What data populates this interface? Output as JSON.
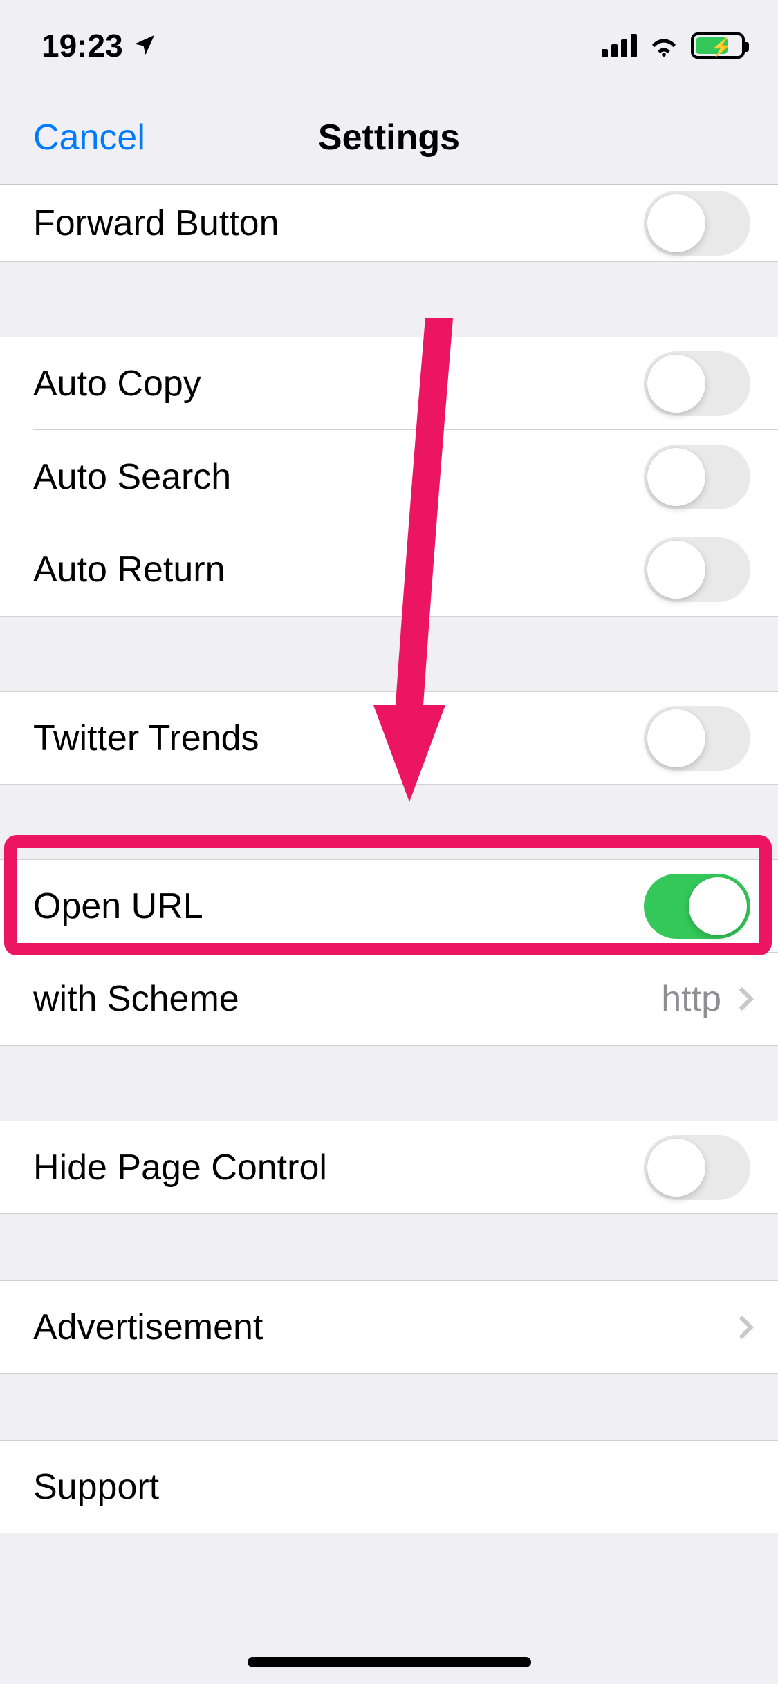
{
  "status": {
    "time": "19:23"
  },
  "nav": {
    "cancel": "Cancel",
    "title": "Settings"
  },
  "rows": {
    "forward_button": "Forward Button",
    "auto_copy": "Auto Copy",
    "auto_search": "Auto Search",
    "auto_return": "Auto Return",
    "twitter_trends": "Twitter Trends",
    "open_url": "Open URL",
    "with_scheme_label": "with Scheme",
    "with_scheme_value": "http",
    "hide_page_control": "Hide Page Control",
    "advertisement": "Advertisement",
    "support": "Support"
  },
  "switches": {
    "forward_button": false,
    "auto_copy": false,
    "auto_search": false,
    "auto_return": false,
    "twitter_trends": false,
    "open_url": true,
    "hide_page_control": false
  },
  "colors": {
    "accent": "#007aff",
    "switch_on": "#34c759",
    "annotation": "#ec1561"
  }
}
